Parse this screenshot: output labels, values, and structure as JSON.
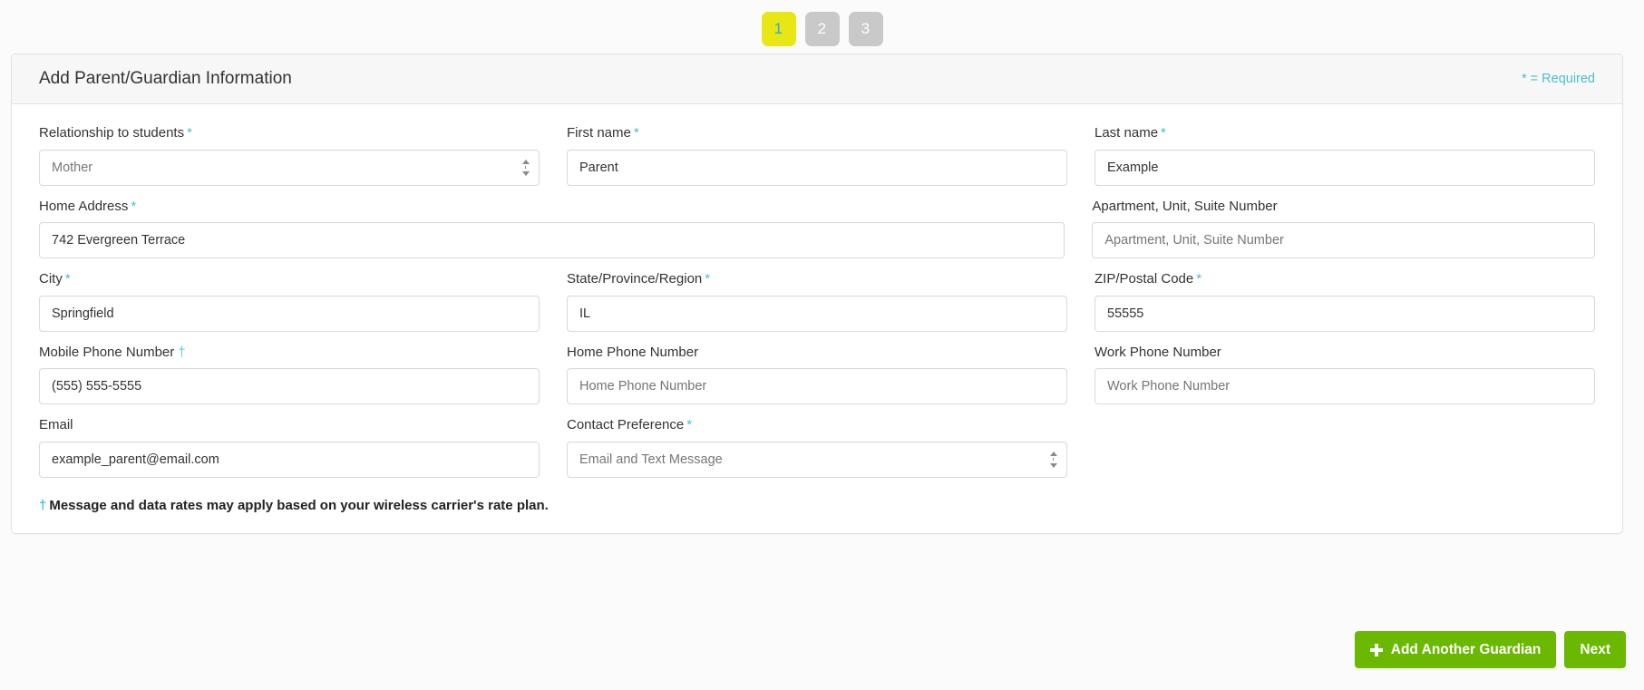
{
  "steps": [
    {
      "label": "1",
      "state": "active"
    },
    {
      "label": "2",
      "state": "inactive"
    },
    {
      "label": "3",
      "state": "inactive"
    }
  ],
  "panel": {
    "title": "Add Parent/Guardian Information",
    "required_note": "* = Required"
  },
  "fields": {
    "relationship": {
      "label": "Relationship to students",
      "required_marker": "*",
      "value": "Mother"
    },
    "first_name": {
      "label": "First name",
      "required_marker": "*",
      "value": "Parent",
      "placeholder": "First name"
    },
    "last_name": {
      "label": "Last name",
      "required_marker": "*",
      "value": "Example",
      "placeholder": "Last name"
    },
    "home_address": {
      "label": "Home Address",
      "required_marker": "*",
      "value": "742 Evergreen Terrace",
      "placeholder": "Home Address"
    },
    "apartment": {
      "label": "Apartment, Unit, Suite Number",
      "value": "",
      "placeholder": "Apartment, Unit, Suite Number"
    },
    "city": {
      "label": "City",
      "required_marker": "*",
      "value": "Springfield",
      "placeholder": "City"
    },
    "state": {
      "label": "State/Province/Region",
      "required_marker": "*",
      "value": "IL",
      "placeholder": "State/Province/Region"
    },
    "zip": {
      "label": "ZIP/Postal Code",
      "required_marker": "*",
      "value": "55555",
      "placeholder": "ZIP/Postal Code"
    },
    "mobile_phone": {
      "label": "Mobile Phone Number",
      "required_marker": "†",
      "value": "(555) 555-5555",
      "placeholder": "Mobile Phone Number"
    },
    "home_phone": {
      "label": "Home Phone Number",
      "value": "",
      "placeholder": "Home Phone Number"
    },
    "work_phone": {
      "label": "Work Phone Number",
      "value": "",
      "placeholder": "Work Phone Number"
    },
    "email": {
      "label": "Email",
      "value": "example_parent@email.com",
      "placeholder": "Email"
    },
    "contact_preference": {
      "label": "Contact Preference",
      "required_marker": "*",
      "value": "Email and Text Message"
    }
  },
  "footnote": {
    "dagger": "†",
    "text": "Message and data rates may apply based on your wireless carrier's rate plan."
  },
  "buttons": {
    "add_guardian": "Add Another Guardian",
    "next": "Next"
  },
  "colors": {
    "accent_green": "#6ab800",
    "step_active_bg": "#e8e614",
    "step_active_text": "#29abe2",
    "step_inactive_bg": "#c9c9c9",
    "required_teal": "#4bc0c8",
    "dagger_blue": "#5bc8e8"
  }
}
